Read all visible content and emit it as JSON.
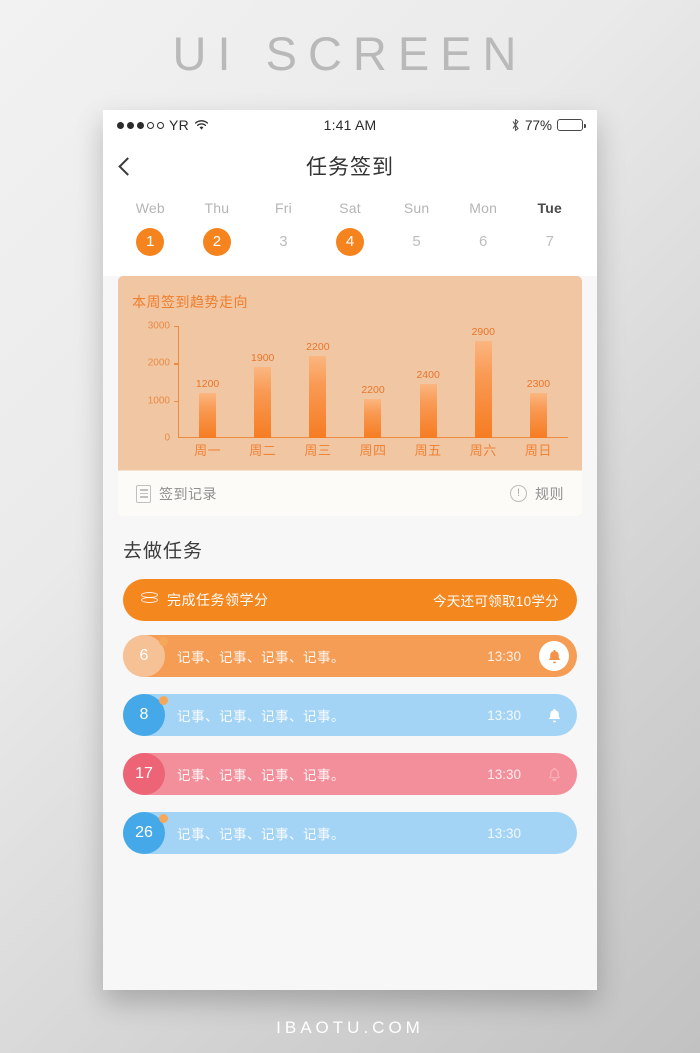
{
  "watermark": {
    "top": "UI SCREEN",
    "bottom": "IBAOTU.COM"
  },
  "status_bar": {
    "carrier": "YR",
    "signal_filled": 3,
    "signal_total": 5,
    "wifi_icon": "wifi-icon",
    "time": "1:41 AM",
    "bluetooth_icon": "bluetooth-icon",
    "battery_percent": "77%",
    "battery_level": 70
  },
  "nav": {
    "back_icon": "back-chevron-icon",
    "title": "任务签到"
  },
  "week": {
    "days": [
      {
        "label": "Web",
        "num": "1",
        "checked": true,
        "active": false
      },
      {
        "label": "Thu",
        "num": "2",
        "checked": true,
        "active": false
      },
      {
        "label": "Fri",
        "num": "3",
        "checked": false,
        "active": false
      },
      {
        "label": "Sat",
        "num": "4",
        "checked": true,
        "active": false
      },
      {
        "label": "Sun",
        "num": "5",
        "checked": false,
        "active": false
      },
      {
        "label": "Mon",
        "num": "6",
        "checked": false,
        "active": false
      },
      {
        "label": "Tue",
        "num": "7",
        "checked": false,
        "active": true
      }
    ]
  },
  "chart_data": {
    "type": "bar",
    "title": "本周签到趋势走向",
    "categories": [
      "周一",
      "周二",
      "周三",
      "周四",
      "周五",
      "周六",
      "周日"
    ],
    "values": [
      1200,
      1900,
      2200,
      2200,
      2400,
      2900,
      2300
    ],
    "bar_heights": [
      1200,
      1900,
      2200,
      1050,
      1450,
      2750,
      1200
    ],
    "data_labels": [
      "1200",
      "1900",
      "2200",
      "2200",
      "2400",
      "2900",
      "2300"
    ],
    "yticks": [
      0,
      1000,
      2000,
      3000
    ],
    "ytick_labels": [
      "0",
      "1000",
      "2000",
      "3000"
    ],
    "ylim": [
      0,
      3000
    ],
    "xlabel": "",
    "ylabel": "",
    "grid": false,
    "legend": false,
    "colors": {
      "bar_top": "#fbb680",
      "bar_bottom": "#f67c22",
      "axis": "#f08a3e",
      "card_bg": "#f1c6a3",
      "title": "#ef7e2c"
    }
  },
  "record_bar": {
    "left": {
      "icon": "document-icon",
      "label": "签到记录"
    },
    "right": {
      "icon": "exclamation-circle-icon",
      "label": "规则"
    }
  },
  "tasks_section": {
    "title": "去做任务",
    "reward": {
      "icon": "coins-icon",
      "label": "完成任务领学分",
      "note": "今天还可领取10学分",
      "color": "#f5871f"
    },
    "rows": [
      {
        "badge": "6",
        "text": "记事、记事、记事、记事。",
        "time": "13:30",
        "row_color": "#f59c55",
        "badge_color": "#f7c196",
        "badge_text_color": "#ffffff",
        "bell": "filled",
        "dot": true
      },
      {
        "badge": "8",
        "text": "记事、记事、记事、记事。",
        "time": "13:30",
        "row_color": "#a4d4f5",
        "badge_color": "#45a8e8",
        "badge_text_color": "#ffffff",
        "bell": "solid",
        "dot": true
      },
      {
        "badge": "17",
        "text": "记事、记事、记事、记事。",
        "time": "13:30",
        "row_color": "#f38e9b",
        "badge_color": "#ed6476",
        "badge_text_color": "#ffffff",
        "bell": "outline",
        "dot": false
      },
      {
        "badge": "26",
        "text": "记事、记事、记事、记事。",
        "time": "13:30",
        "row_color": "#a4d4f5",
        "badge_color": "#45a8e8",
        "badge_text_color": "#ffffff",
        "bell": "none",
        "dot": true
      }
    ]
  }
}
